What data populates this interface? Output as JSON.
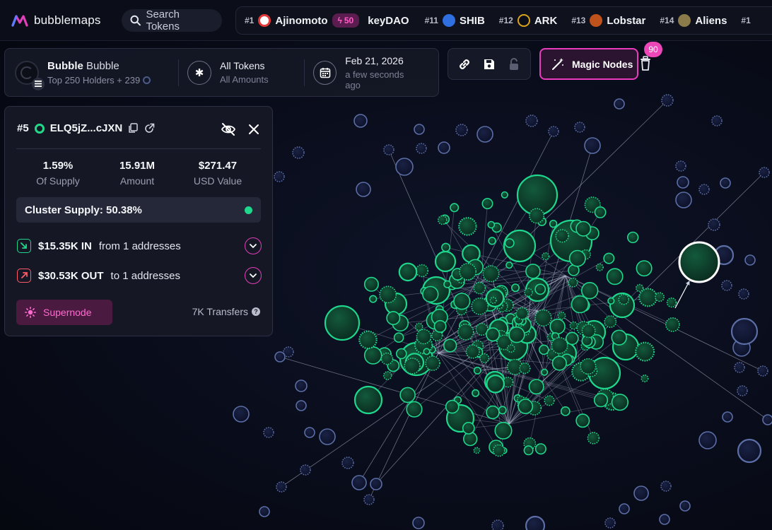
{
  "brand": {
    "name": "bubblemaps"
  },
  "search": {
    "label": "Search Tokens"
  },
  "ticker": [
    {
      "rank": "#1",
      "name": "Ajinomoto",
      "icon": "ajinomoto-icon",
      "color": "#e23a3a",
      "badge": "50"
    },
    {
      "rank": "",
      "name": "keyDAO",
      "icon": "",
      "color": "",
      "badge": ""
    },
    {
      "rank": "#11",
      "name": "SHIB",
      "icon": "shib-icon",
      "color": "#2f6fe0",
      "badge": ""
    },
    {
      "rank": "#12",
      "name": "ARK",
      "icon": "ark-icon",
      "color": "#d9a21b",
      "badge": ""
    },
    {
      "rank": "#13",
      "name": "Lobstar",
      "icon": "lobstar-icon",
      "color": "#c0521c",
      "badge": ""
    },
    {
      "rank": "#14",
      "name": "Aliens",
      "icon": "aliens-icon",
      "color": "#8b7a4a",
      "badge": ""
    },
    {
      "rank": "#1",
      "name": "",
      "icon": "",
      "color": "",
      "badge": ""
    }
  ],
  "token": {
    "name": "Bubble",
    "symbol": "Bubble",
    "holders": "Top 250 Holders + 239"
  },
  "filters": {
    "tokens_title": "All Tokens",
    "tokens_sub": "All Amounts",
    "date_title": "Feb 21, 2026",
    "date_sub": "a few seconds ago"
  },
  "magic": {
    "label": "Magic Nodes",
    "count": "90"
  },
  "holder": {
    "rank": "#5",
    "address": "ELQ5jZ...cJXN",
    "supply_pct": "1.59%",
    "supply_label": "Of Supply",
    "amount": "15.91M",
    "amount_label": "Amount",
    "usd": "$271.47",
    "usd_label": "USD Value",
    "cluster": "Cluster Supply: 50.38%",
    "in_value": "$15.35K IN",
    "in_rest": "from 1 addresses",
    "out_value": "$30.53K OUT",
    "out_rest": "to 1 addresses",
    "supernode": "Supernode",
    "transfers": "7K Transfers"
  },
  "colors": {
    "accent": "#e93cbd",
    "node_green": "#1fd78c",
    "node_blue": "#5c6ea6",
    "background": "#090c1a"
  }
}
